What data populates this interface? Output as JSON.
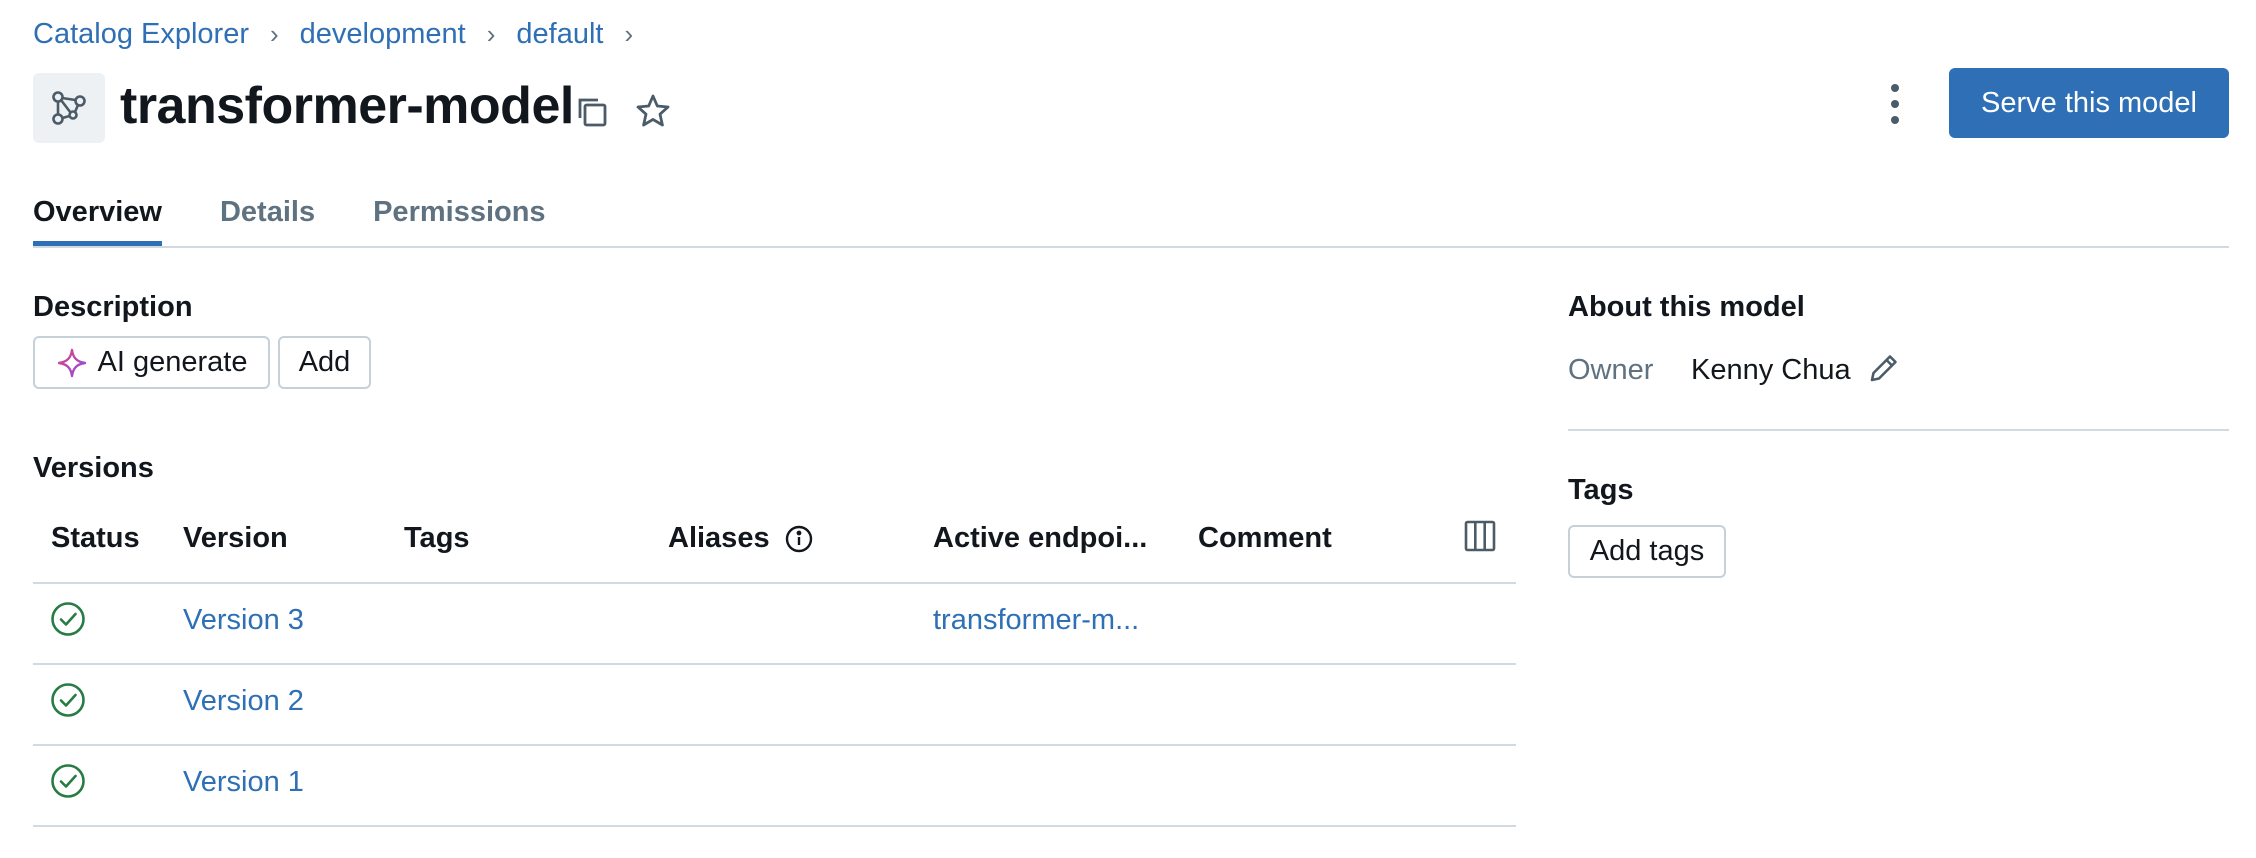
{
  "breadcrumb": {
    "items": [
      "Catalog Explorer",
      "development",
      "default"
    ],
    "separator": "›"
  },
  "header": {
    "title": "transformer-model",
    "serve_button": "Serve this model"
  },
  "tabs": [
    {
      "label": "Overview",
      "active": true
    },
    {
      "label": "Details",
      "active": false
    },
    {
      "label": "Permissions",
      "active": false
    }
  ],
  "description": {
    "label": "Description",
    "ai_generate": "AI generate",
    "add": "Add"
  },
  "versions": {
    "label": "Versions",
    "columns": [
      "Status",
      "Version",
      "Tags",
      "Aliases",
      "Active endpoi...",
      "Comment"
    ],
    "rows": [
      {
        "status": "ready",
        "version": "Version 3",
        "tags": "",
        "aliases": "",
        "endpoint": "transformer-m...",
        "comment": ""
      },
      {
        "status": "ready",
        "version": "Version 2",
        "tags": "",
        "aliases": "",
        "endpoint": "",
        "comment": ""
      },
      {
        "status": "ready",
        "version": "Version 1",
        "tags": "",
        "aliases": "",
        "endpoint": "",
        "comment": ""
      }
    ]
  },
  "about": {
    "label": "About this model",
    "owner_label": "Owner",
    "owner_value": "Kenny Chua"
  },
  "tags_panel": {
    "label": "Tags",
    "add_tags": "Add tags"
  },
  "colors": {
    "accent": "#2f6fb5",
    "success": "#277c43",
    "text": "#11171c",
    "muted": "#5f7281",
    "border": "#d1d9e1"
  },
  "icons": [
    "model-icon",
    "copy-icon",
    "star-icon",
    "kebab-menu-icon",
    "sparkle-icon",
    "info-icon",
    "columns-icon",
    "check-circle-icon",
    "pencil-icon"
  ]
}
